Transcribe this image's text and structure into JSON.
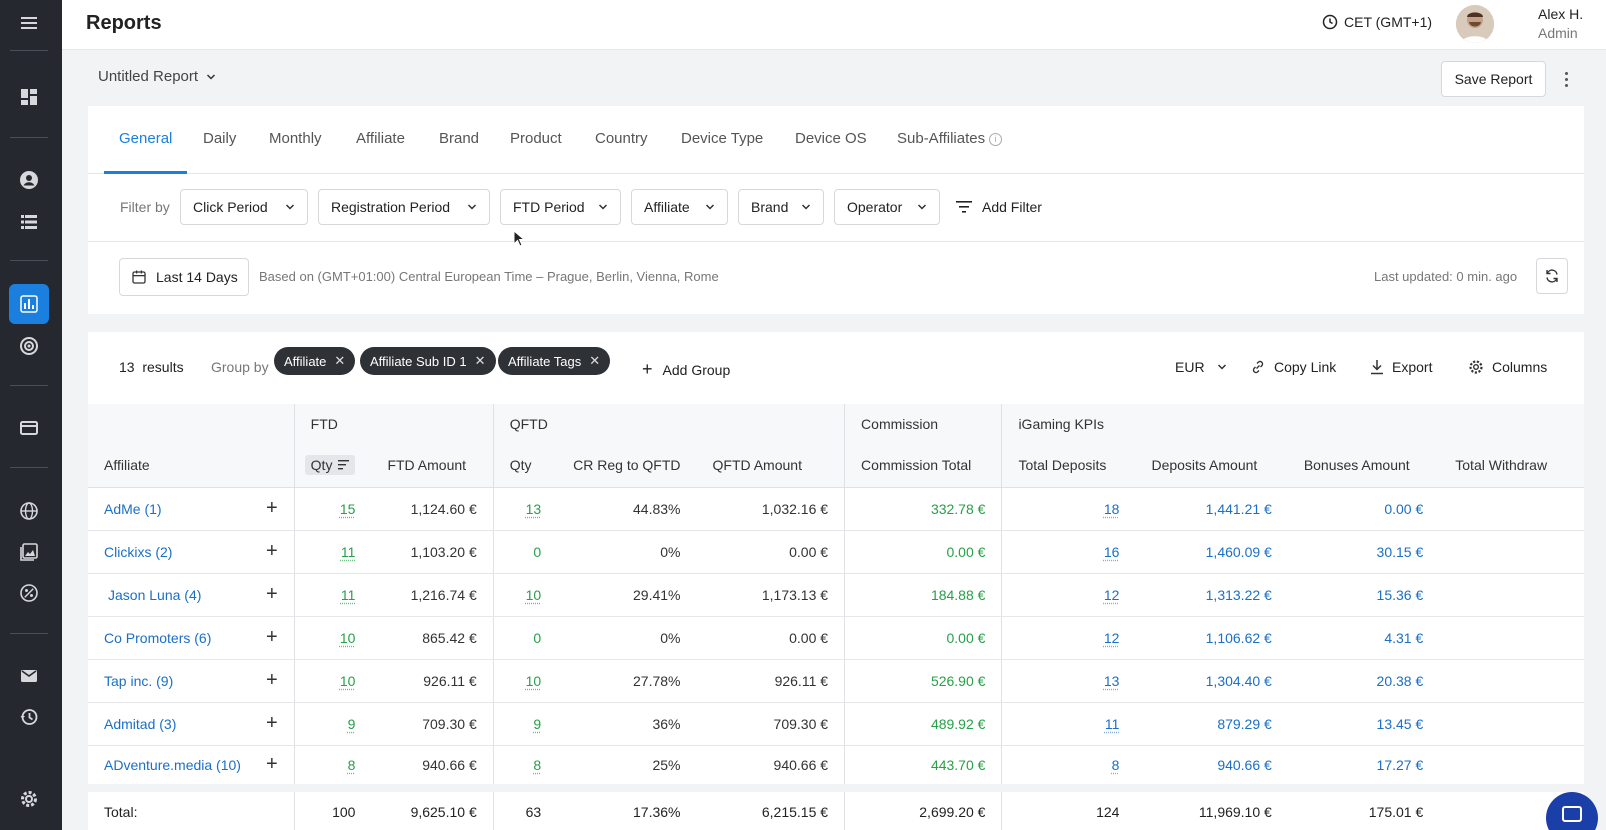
{
  "header": {
    "title": "Reports",
    "timezone": "CET (GMT+1)",
    "user_name": "Alex H.",
    "user_role": "Admin"
  },
  "report": {
    "name": "Untitled Report",
    "save_label": "Save Report"
  },
  "tabs": [
    {
      "label": "General",
      "active": true
    },
    {
      "label": "Daily"
    },
    {
      "label": "Monthly"
    },
    {
      "label": "Affiliate"
    },
    {
      "label": "Brand"
    },
    {
      "label": "Product"
    },
    {
      "label": "Country"
    },
    {
      "label": "Device Type"
    },
    {
      "label": "Device OS"
    },
    {
      "label": "Sub-Affiliates"
    }
  ],
  "filters": {
    "label": "Filter by",
    "items": [
      "Click Period",
      "Registration Period",
      "FTD Period",
      "Affiliate",
      "Brand",
      "Operator"
    ],
    "add_label": "Add Filter"
  },
  "date": {
    "range_label": "Last 14 Days",
    "tz_note": "Based on (GMT+01:00) Central European Time – Prague, Berlin, Vienna, Rome",
    "last_updated": "Last updated: 0 min. ago"
  },
  "results": {
    "count": "13",
    "count_label": "results",
    "group_label": "Group by",
    "groups": [
      "Affiliate",
      "Affiliate Sub ID 1",
      "Affiliate Tags"
    ],
    "add_group_label": "Add Group",
    "currency": "EUR",
    "copy_link": "Copy Link",
    "export": "Export",
    "columns": "Columns"
  },
  "table": {
    "groups": {
      "ftd": "FTD",
      "qftd": "QFTD",
      "commission": "Commission",
      "igaming": "iGaming KPIs"
    },
    "headers": {
      "affiliate": "Affiliate",
      "ftd_qty": "Qty",
      "ftd_amount": "FTD Amount",
      "qftd_qty": "Qty",
      "cr": "CR Reg to QFTD",
      "qftd_amount": "QFTD Amount",
      "commission_total": "Commission Total",
      "total_deposits": "Total Deposits",
      "deposits_amount": "Deposits Amount",
      "bonuses_amount": "Bonuses Amount",
      "total_withdraw": "Total Withdraw"
    },
    "rows": [
      {
        "affiliate": "AdMe (1)",
        "ftd_qty": "15",
        "ftd_amount": "1,124.60 €",
        "qftd_qty": "13",
        "cr": "44.83%",
        "qftd_amount": "1,032.16 €",
        "commission": "332.78 €",
        "deposits": "18",
        "deposits_amount": "1,441.21 €",
        "bonuses": "0.00 €"
      },
      {
        "affiliate": "Clickixs (2)",
        "ftd_qty": "11",
        "ftd_amount": "1,103.20 €",
        "qftd_qty": "0",
        "cr": "0%",
        "qftd_amount": "0.00 €",
        "commission": "0.00 €",
        "deposits": "16",
        "deposits_amount": "1,460.09 €",
        "bonuses": "30.15 €"
      },
      {
        "affiliate": "Jason Luna (4)",
        "ftd_qty": "11",
        "ftd_amount": "1,216.74 €",
        "qftd_qty": "10",
        "cr": "29.41%",
        "qftd_amount": "1,173.13 €",
        "commission": "184.88 €",
        "deposits": "12",
        "deposits_amount": "1,313.22 €",
        "bonuses": "15.36 €"
      },
      {
        "affiliate": "Co Promoters (6)",
        "ftd_qty": "10",
        "ftd_amount": "865.42 €",
        "qftd_qty": "0",
        "cr": "0%",
        "qftd_amount": "0.00 €",
        "commission": "0.00 €",
        "deposits": "12",
        "deposits_amount": "1,106.62 €",
        "bonuses": "4.31 €"
      },
      {
        "affiliate": "Tap inc. (9)",
        "ftd_qty": "10",
        "ftd_amount": "926.11 €",
        "qftd_qty": "10",
        "cr": "27.78%",
        "qftd_amount": "926.11 €",
        "commission": "526.90 €",
        "deposits": "13",
        "deposits_amount": "1,304.40 €",
        "bonuses": "20.38 €"
      },
      {
        "affiliate": "Admitad (3)",
        "ftd_qty": "9",
        "ftd_amount": "709.30 €",
        "qftd_qty": "9",
        "cr": "36%",
        "qftd_amount": "709.30 €",
        "commission": "489.92 €",
        "deposits": "11",
        "deposits_amount": "879.29 €",
        "bonuses": "13.45 €"
      },
      {
        "affiliate": "ADventure.media (10)",
        "ftd_qty": "8",
        "ftd_amount": "940.66 €",
        "qftd_qty": "8",
        "cr": "25%",
        "qftd_amount": "940.66 €",
        "commission": "443.70 €",
        "deposits": "8",
        "deposits_amount": "940.66 €",
        "bonuses": "17.27 €"
      }
    ],
    "total": {
      "label": "Total:",
      "ftd_qty": "100",
      "ftd_amount": "9,625.10 €",
      "qftd_qty": "63",
      "cr": "17.36%",
      "qftd_amount": "6,215.15 €",
      "commission": "2,699.20 €",
      "deposits": "124",
      "deposits_amount": "11,969.10 €",
      "bonuses": "175.01 €"
    }
  },
  "icons": {
    "menu": "hamburger-icon",
    "dashboard": "dashboard-icon",
    "user": "user-icon",
    "list": "list-icon",
    "reports": "bar-chart-icon",
    "target": "target-icon",
    "payments": "credit-card-icon",
    "globe": "globe-icon",
    "media": "image-icon",
    "percent": "percent-icon",
    "mail": "mail-icon",
    "history": "history-icon",
    "settings": "gear-icon"
  },
  "colors": {
    "accent": "#1b7fe0",
    "positive": "#27a047",
    "link": "#1b6fc7",
    "sidebar": "#25282e"
  }
}
